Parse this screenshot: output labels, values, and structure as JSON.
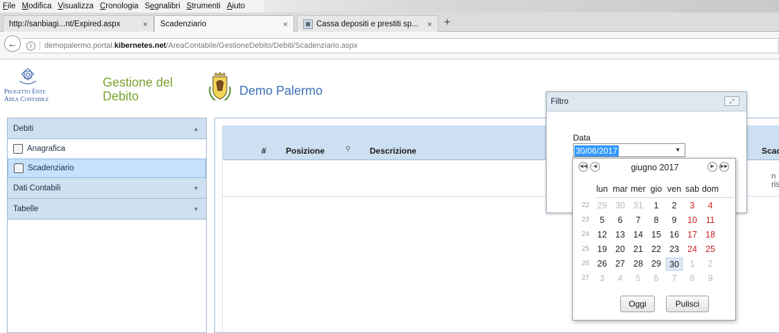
{
  "browser": {
    "menu": [
      {
        "accel": "F",
        "rest": "ile"
      },
      {
        "accel": "M",
        "rest": "odifica"
      },
      {
        "accel": "V",
        "rest": "isualizza"
      },
      {
        "accel": "C",
        "rest": "ronologia"
      },
      {
        "pre": "S",
        "accel": "e",
        "rest": "gnalibri"
      },
      {
        "accel": "S",
        "rest": "trumenti"
      },
      {
        "accel": "A",
        "rest": "iuto"
      }
    ],
    "tabs": [
      {
        "title": "http://sanbiagi...nt/Expired.aspx"
      },
      {
        "title": "Scadenziario"
      },
      {
        "title": "Cassa depositi e prestiti sp..."
      }
    ],
    "tab_close": "×",
    "new_tab": "+",
    "url": {
      "prefix": "demopalermo.portal.",
      "domain": "kibernetes.net",
      "path": "/AreaContabile/GestioneDebito/Debiti/Scadenziario.aspx"
    }
  },
  "header": {
    "brand_line1": "Progetto Ente",
    "brand_line2": "Area Contabile",
    "app_title": "Gestione del Debito",
    "ente_name": "Demo Palermo"
  },
  "sidebar": {
    "sections": [
      {
        "label": "Debiti",
        "expanded": true
      },
      {
        "label": "Dati Contabili",
        "expanded": false
      },
      {
        "label": "Tabelle",
        "expanded": false
      }
    ],
    "items": [
      {
        "label": "Anagrafica",
        "active": false,
        "icon": "gauge-icon"
      },
      {
        "label": "Scadenziario",
        "active": true,
        "icon": "clock-icon"
      }
    ]
  },
  "grid": {
    "columns": [
      "#",
      "Posizione",
      "Descrizione"
    ],
    "partial_column": "Scad",
    "empty_text": "n risul"
  },
  "filter": {
    "title": "Filtro",
    "date_label": "Data",
    "date_value": "30/06/2017"
  },
  "calendar": {
    "month_title": "giugno 2017",
    "weekdays": [
      "lun",
      "mar",
      "mer",
      "gio",
      "ven",
      "sab",
      "dom"
    ],
    "weeks": [
      {
        "wk": "22",
        "days": [
          "29",
          "30",
          "31",
          "1",
          "2",
          "3",
          "4"
        ]
      },
      {
        "wk": "23",
        "days": [
          "5",
          "6",
          "7",
          "8",
          "9",
          "10",
          "11"
        ]
      },
      {
        "wk": "24",
        "days": [
          "12",
          "13",
          "14",
          "15",
          "16",
          "17",
          "18"
        ]
      },
      {
        "wk": "25",
        "days": [
          "19",
          "20",
          "21",
          "22",
          "23",
          "24",
          "25"
        ]
      },
      {
        "wk": "26",
        "days": [
          "26",
          "27",
          "28",
          "29",
          "30",
          "1",
          "2"
        ]
      },
      {
        "wk": "27",
        "days": [
          "3",
          "4",
          "5",
          "6",
          "7",
          "8",
          "9"
        ]
      }
    ],
    "selected_day": "30",
    "today_label": "Oggi",
    "clear_label": "Pulisci",
    "colors": {
      "weekend": "#cc1f1f",
      "other_month": "#bbbbbb",
      "selected_bg": "#dfe8f6"
    }
  }
}
